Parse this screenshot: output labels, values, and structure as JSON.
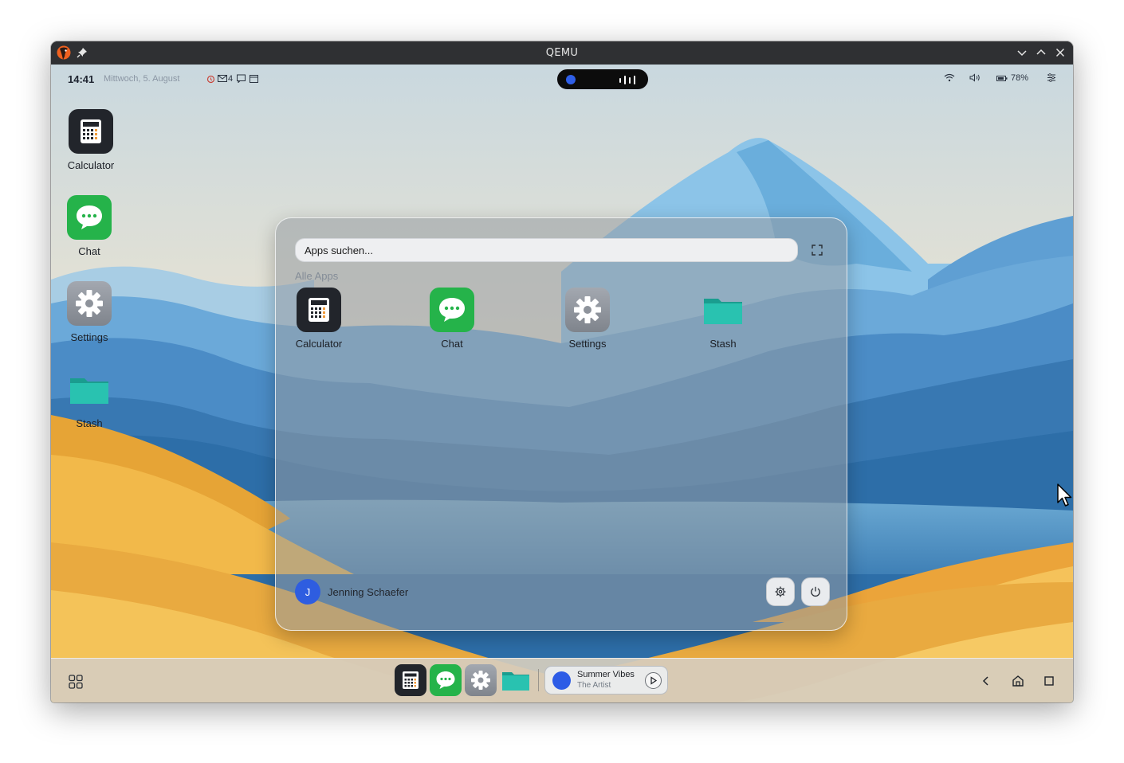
{
  "window": {
    "title": "QEMU"
  },
  "statusbar": {
    "time": "14:41",
    "date": "Mittwoch, 5. August",
    "notification_count": "4",
    "battery": "78%"
  },
  "desktop": {
    "icons": [
      {
        "label": "Calculator",
        "icon": "calculator-icon"
      },
      {
        "label": "Chat",
        "icon": "chat-icon"
      },
      {
        "label": "Settings",
        "icon": "gear-icon"
      },
      {
        "label": "Stash",
        "icon": "folder-icon"
      }
    ]
  },
  "launcher": {
    "search_placeholder": "Apps suchen...",
    "section_title": "Alle Apps",
    "apps": [
      {
        "label": "Calculator",
        "icon": "calculator-icon"
      },
      {
        "label": "Chat",
        "icon": "chat-icon"
      },
      {
        "label": "Settings",
        "icon": "gear-icon"
      },
      {
        "label": "Stash",
        "icon": "folder-icon"
      }
    ],
    "user": {
      "initial": "J",
      "name": "Jenning Schaefer"
    }
  },
  "taskbar": {
    "media": {
      "title": "Summer Vibes",
      "artist": "The Artist"
    }
  },
  "colors": {
    "accent": "#2e5de0",
    "calculator_bg": "#22252b",
    "chat_bg": "#25b34a",
    "settings_bg": "#8e939b",
    "folder": "#22b7a6"
  }
}
